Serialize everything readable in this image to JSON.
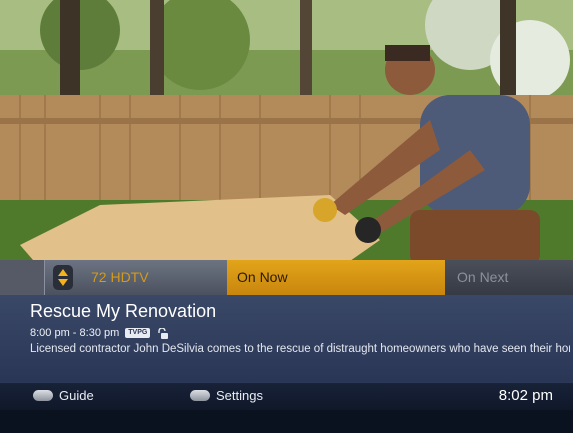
{
  "channel": {
    "name": "72 HDTV"
  },
  "tabs": {
    "now": "On Now",
    "next": "On Next"
  },
  "program": {
    "title": "Rescue My Renovation",
    "time": "8:00 pm - 8:30 pm",
    "rating": "TVPG",
    "description": "Licensed contractor John DeSilvia comes to the rescue of distraught homeowners who have seen their homes left in shambles by the contractor..."
  },
  "footer_buttons": {
    "guide": "Guide",
    "settings": "Settings"
  },
  "clock": "8:02 pm",
  "icons": {
    "channel_arrows": "up-down-arrows-icon",
    "lock": "lock-icon",
    "guide": "guide-button-icon",
    "settings": "menu-button-icon"
  },
  "colors": {
    "accent": "#e2a41a",
    "panel": "#2a3656",
    "bar": "#0f1829"
  }
}
